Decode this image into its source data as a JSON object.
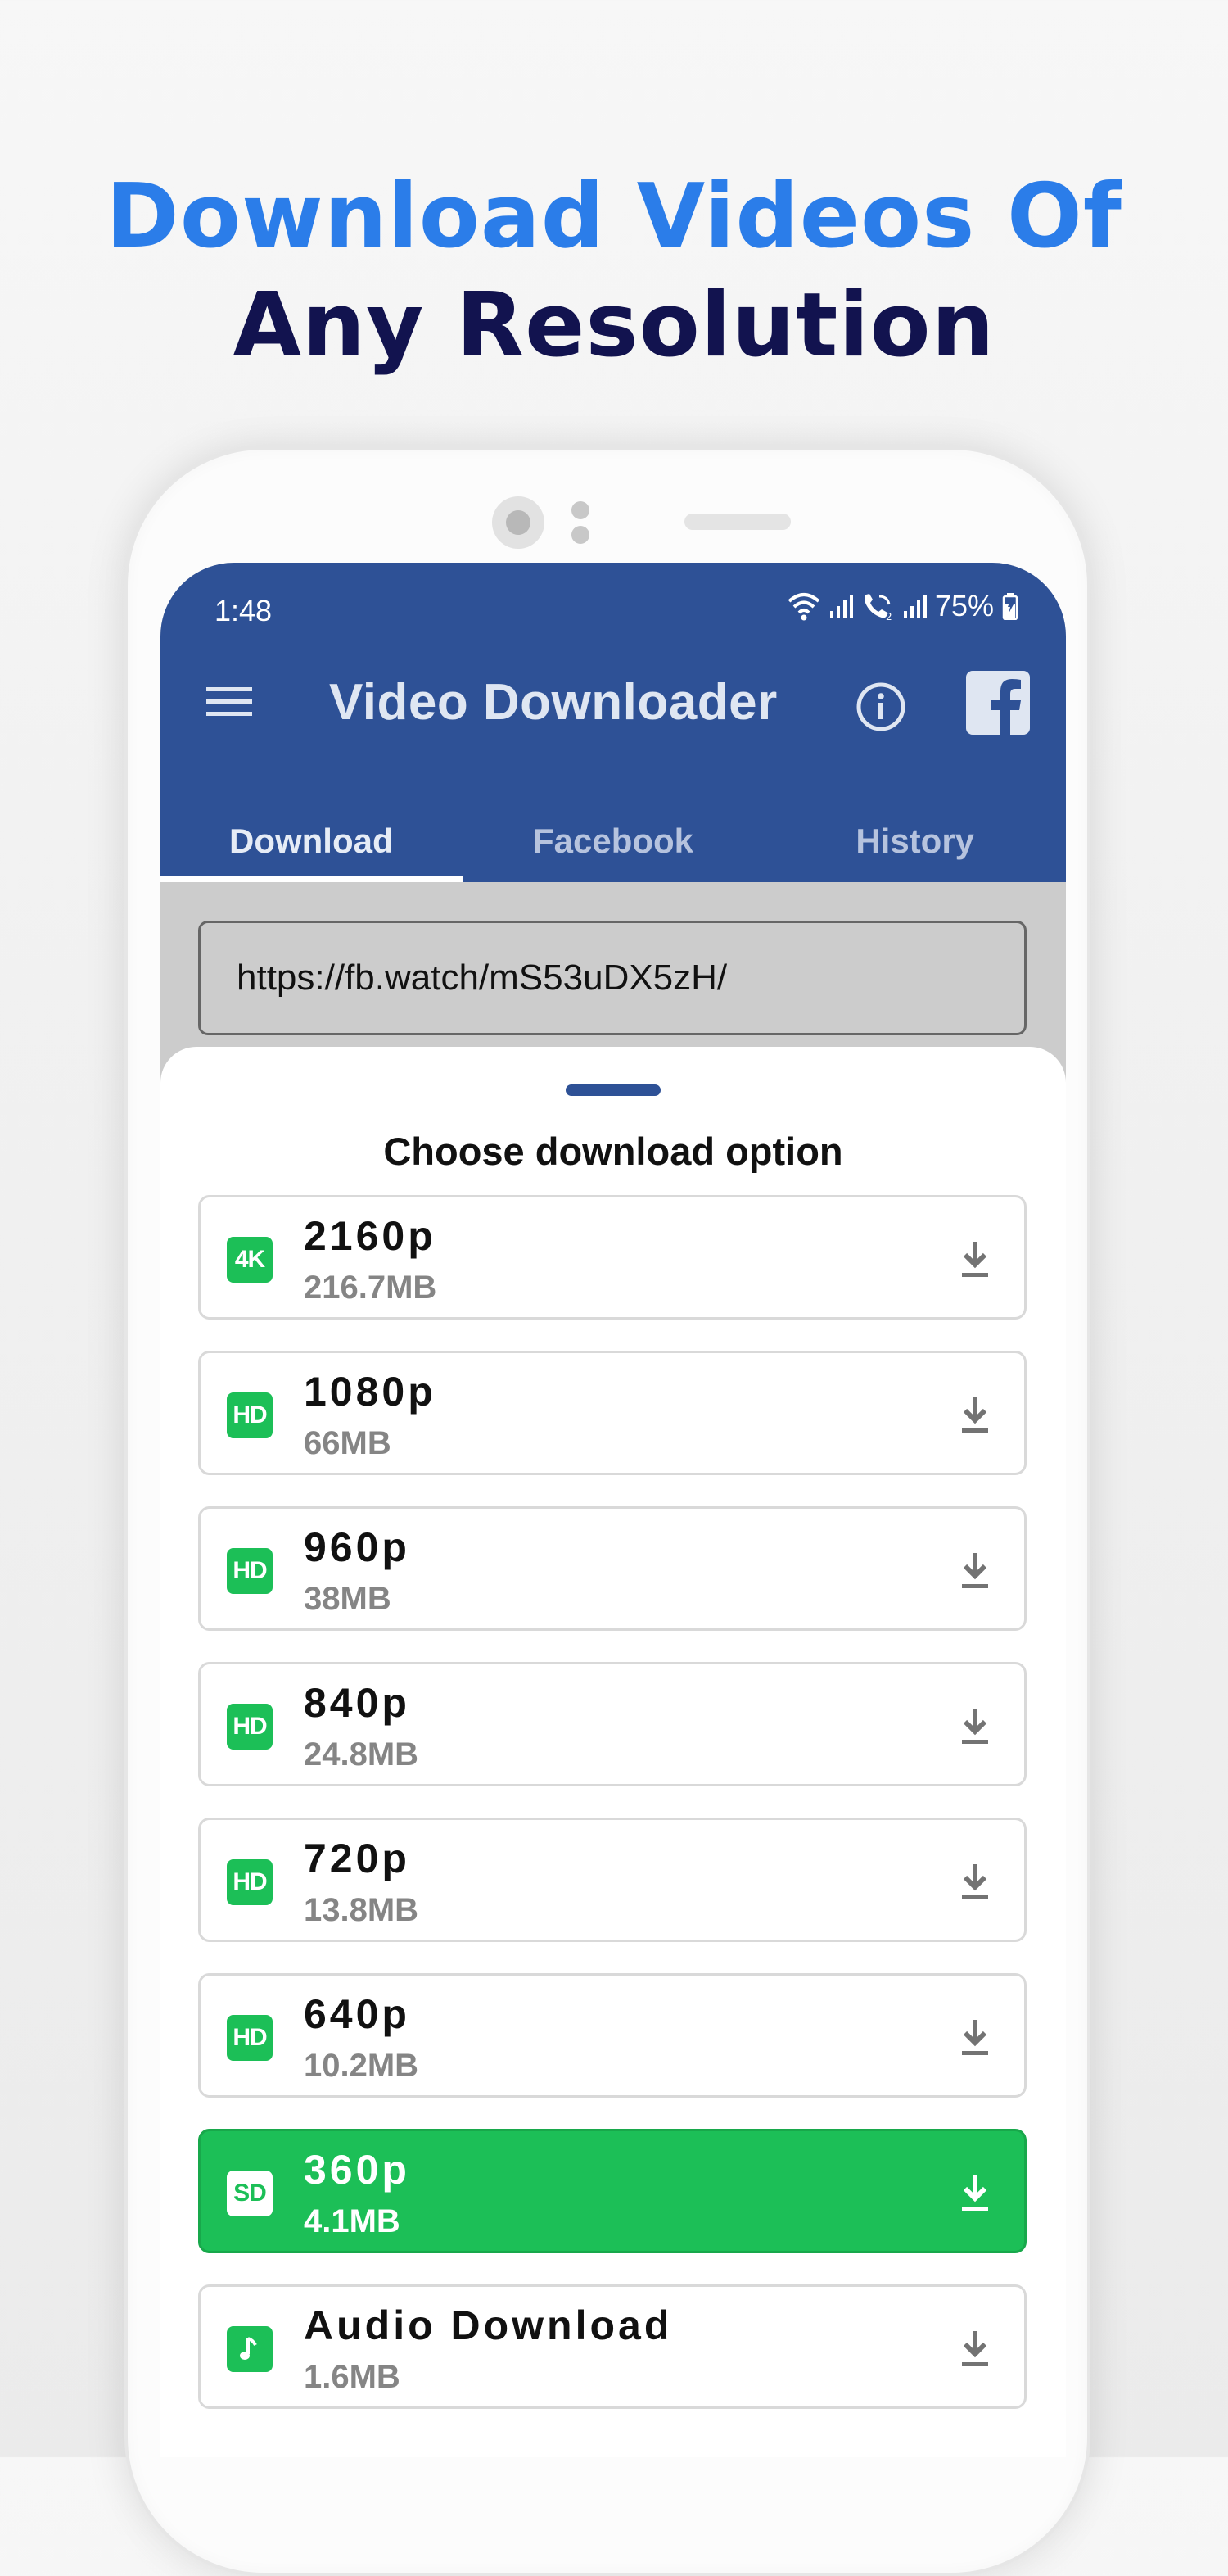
{
  "headline": {
    "line1": "Download Videos Of",
    "line2": "Any Resolution"
  },
  "status_bar": {
    "time": "1:48",
    "battery": "75%",
    "icons": [
      "wifi-icon",
      "signal-icon",
      "wifi-call-icon",
      "signal-icon",
      "battery-icon"
    ]
  },
  "app_bar": {
    "title": "Video Downloader",
    "left_icon": "menu-icon",
    "right_icons": [
      "info-icon",
      "facebook-icon"
    ]
  },
  "tabs": [
    {
      "label": "Download",
      "active": true
    },
    {
      "label": "Facebook",
      "active": false
    },
    {
      "label": "History",
      "active": false
    }
  ],
  "url_input": {
    "value": "https://fb.watch/mS53uDX5zH/"
  },
  "sheet": {
    "title": "Choose download option",
    "options": [
      {
        "badge": "4K",
        "resolution": "2160p",
        "size": "216.7MB",
        "selected": false
      },
      {
        "badge": "HD",
        "resolution": "1080p",
        "size": "66MB",
        "selected": false
      },
      {
        "badge": "HD",
        "resolution": "960p",
        "size": "38MB",
        "selected": false
      },
      {
        "badge": "HD",
        "resolution": "840p",
        "size": "24.8MB",
        "selected": false
      },
      {
        "badge": "HD",
        "resolution": "720p",
        "size": "13.8MB",
        "selected": false
      },
      {
        "badge": "HD",
        "resolution": "640p",
        "size": "10.2MB",
        "selected": false
      },
      {
        "badge": "SD",
        "resolution": "360p",
        "size": "4.1MB",
        "selected": true
      },
      {
        "badge": "music-note-icon",
        "resolution": "Audio Download",
        "size": "1.6MB",
        "selected": false
      }
    ]
  },
  "colors": {
    "headline_blue": "#2b7de9",
    "headline_navy": "#12134f",
    "app_bar": "#2e5196",
    "accent_green": "#1cbf57"
  }
}
